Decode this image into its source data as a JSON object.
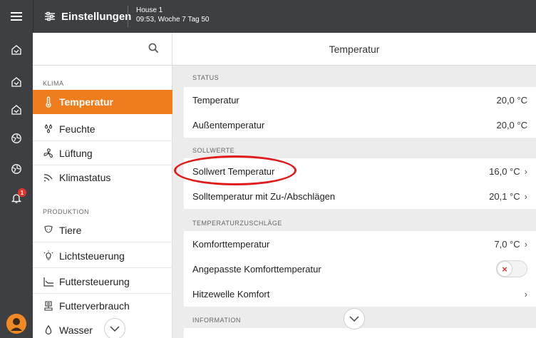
{
  "topbar": {
    "title": "Einstellungen",
    "house_name": "House 1",
    "house_time": "09:53, Woche 7 Tag 50"
  },
  "rail": {
    "alarm_count": "1"
  },
  "menu": {
    "sections": [
      {
        "label": "KLIMA"
      },
      {
        "label": "PRODUKTION"
      }
    ],
    "items": [
      {
        "label": "Temperatur",
        "icon": "thermometer-icon",
        "active": true
      },
      {
        "label": "Feuchte",
        "icon": "humidity-icon"
      },
      {
        "label": "Lüftung",
        "icon": "fan-icon"
      },
      {
        "label": "Klimastatus",
        "icon": "climate-status-icon"
      },
      {
        "label": "Tiere",
        "icon": "animal-icon"
      },
      {
        "label": "Lichtsteuerung",
        "icon": "light-icon"
      },
      {
        "label": "Futtersteuerung",
        "icon": "feed-chart-icon"
      },
      {
        "label": "Futterverbrauch",
        "icon": "feed-scale-icon"
      },
      {
        "label": "Wasser",
        "icon": "water-drop-icon"
      }
    ]
  },
  "content": {
    "title": "Temperatur",
    "sections": [
      {
        "label": "STATUS"
      },
      {
        "label": "SOLLWERTE"
      },
      {
        "label": "TEMPERATURZUSCHLÄGE"
      },
      {
        "label": "INFORMATION"
      }
    ],
    "rows": [
      {
        "label": "Temperatur",
        "value": "20,0 °C"
      },
      {
        "label": "Außentemperatur",
        "value": "20,0 °C"
      },
      {
        "label": "Sollwert Temperatur",
        "value": "16,0 °C"
      },
      {
        "label": "Solltemperatur mit Zu-/Abschlägen",
        "value": "20,1 °C"
      },
      {
        "label": "Komforttemperatur",
        "value": "7,0 °C"
      },
      {
        "label": "Angepasste Komforttemperatur",
        "value": ""
      },
      {
        "label": "Hitzewelle Komfort",
        "value": ""
      }
    ],
    "toggle_state": "off"
  },
  "colors": {
    "accent": "#ee7d1e",
    "topbar": "#3d3f42",
    "alert": "#e5332a"
  }
}
